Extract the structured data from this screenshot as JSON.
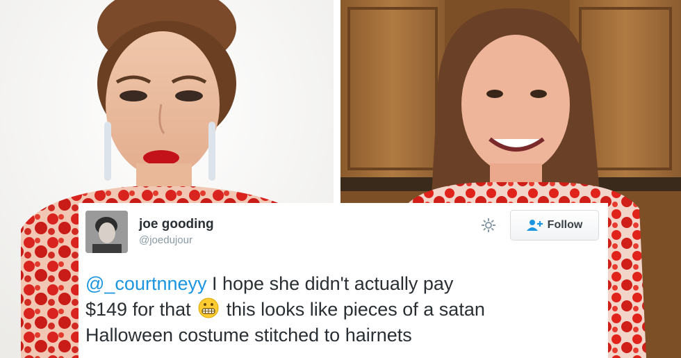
{
  "tweet": {
    "name": "joe gooding",
    "handle": "@joedujour",
    "follow_label": "Follow",
    "mention": "@_courtnneyy",
    "text_line1_rest": " I hope she didn't actually pay",
    "text_line2_start": "$149 for that",
    "text_line2_end": "this looks like pieces of a satan",
    "text_line3": "Halloween costume stitched to hairnets",
    "emoji": "grimacing-face-icon"
  },
  "colors": {
    "link": "#1b95e0",
    "text": "#292f33",
    "muted": "#8899a6",
    "dress_red": "#d8231e"
  }
}
